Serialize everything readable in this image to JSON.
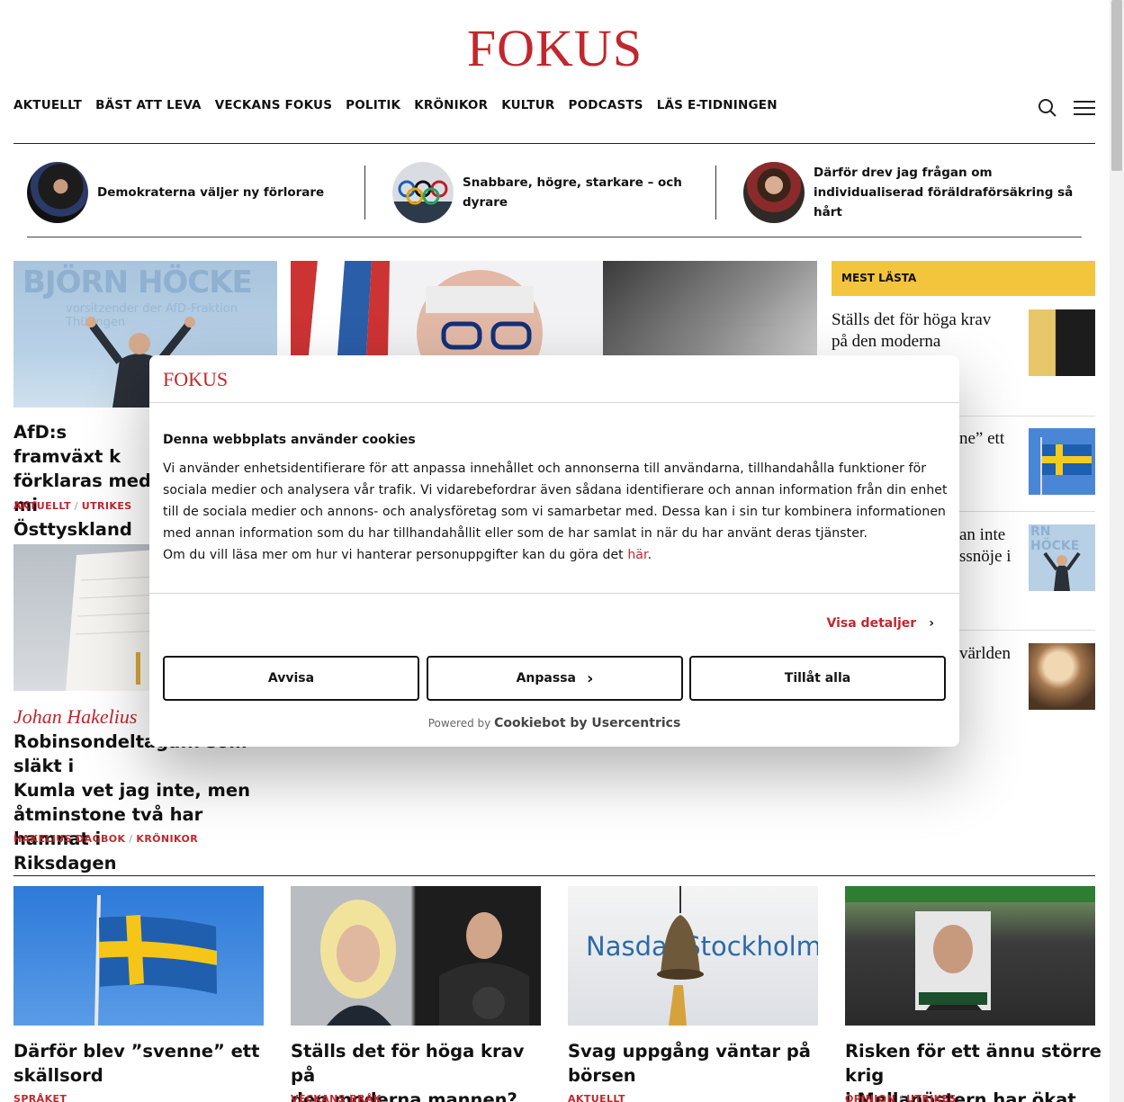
{
  "site": {
    "logo": "FOKUS"
  },
  "nav": [
    "AKTUELLT",
    "BÄST ATT LEVA",
    "VECKANS FOKUS",
    "POLITIK",
    "KRÖNIKOR",
    "KULTUR",
    "PODCASTS",
    "LÄS E-TIDNINGEN"
  ],
  "header_icons": {
    "search": "search-icon",
    "menu": "menu-icon"
  },
  "teasers": [
    {
      "title": "Demokraterna väljer ny förlorare"
    },
    {
      "title": "Snabbare, högre, starkare – och dyrare"
    },
    {
      "title": "Därför drev jag frågan om individualiserad föräldraförsäkring så hårt"
    }
  ],
  "articles": {
    "afd": {
      "headline": "AfD:s framväxt k\nförklaras med mi\nÖsttyskland",
      "tag1": "AKTUELLT",
      "tag2": "UTRIKES",
      "image_text": "BJÖRN HÖCKE",
      "image_sub": "vorsitzender der AfD-Fraktion Thüringen"
    },
    "hakelius": {
      "byline": "Johan Hakelius",
      "headline": "Robinsondeltaga... som släkt i\nKumla vet jag inte, men\nåtminstone två har hamnat i\nRiksdagen",
      "tag1": "HAKELIUS DAGBOK",
      "tag2": "KRÖNIKOR"
    }
  },
  "mest_lasta": {
    "label": "MEST LÄSTA",
    "items": [
      {
        "title": "Ställs det för höga krav\npå den moderna"
      },
      {
        "title": "ne” ett"
      },
      {
        "title": "an inte\nssnöje i"
      },
      {
        "title": "världen"
      }
    ],
    "thumb_text": "RN HÖCKE"
  },
  "bottom_articles": [
    {
      "headline": "Därför blev ”svenne” ett\nskällsord",
      "tag1": "SPRÅKET",
      "tag2": ""
    },
    {
      "headline": "Ställs det för höga krav på\nden moderna mannen?",
      "tag1": "VECKANS BRÅK",
      "tag2": ""
    },
    {
      "headline": "Svag uppgång väntar på\nbörsen",
      "tag1": "AKTUELLT",
      "tag2": "",
      "image_text": "Nasda  Stockholm"
    },
    {
      "headline": "Risken för ett ännu större krig\ni Mellanöstern har ökat",
      "tag1": "OPINION",
      "tag2": "UTRIKES"
    }
  ],
  "cookie_dialog": {
    "logo": "FOKUS",
    "title": "Denna webbplats använder cookies",
    "body": "Vi använder enhetsidentifierare för att anpassa innehållet och annonserna till användarna, tillhandahålla funktioner för sociala medier och analysera vår trafik. Vi vidarebefordrar även sådana identifierare och annan information från din enhet till de sociala medier och annons- och analysföretag som vi samarbetar med. Dessa kan i sin tur kombinera informationen med annan information som du har tillhandahållit eller som de har samlat in när du har använt deras tjänster.",
    "policy_prefix": "Om du vill läsa mer om hur vi hanterar personuppgifter kan du göra det ",
    "policy_link": "här",
    "policy_suffix": ".",
    "details_label": "Visa detaljer",
    "buttons": {
      "reject": "Avvisa",
      "customize": "Anpassa",
      "allow_all": "Tillåt alla"
    },
    "powered_prefix": "Powered by ",
    "powered_brand": "Cookiebot by Usercentrics"
  },
  "colors": {
    "brand": "#c1272d",
    "mest_lasta_bg": "#f2c53d"
  }
}
